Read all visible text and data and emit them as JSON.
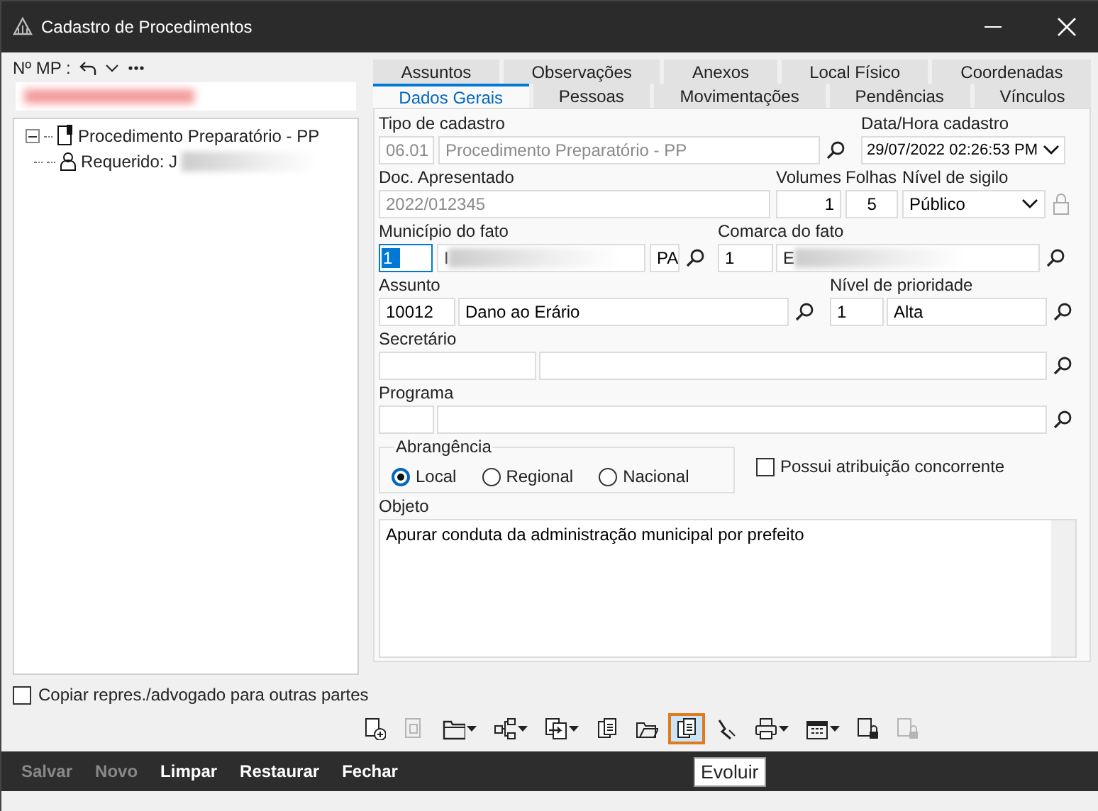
{
  "window": {
    "title": "Cadastro de Procedimentos"
  },
  "mp": {
    "label": "Nº MP :"
  },
  "tree": [
    {
      "label": "Procedimento Preparatório - PP",
      "expanded": true,
      "children": [
        {
          "label": "Requerido: J"
        }
      ]
    }
  ],
  "copy_checkbox": {
    "label": "Copiar repres./advogado para outras partes",
    "checked": false
  },
  "tab_rows": [
    [
      {
        "label": "Assuntos",
        "selected": false
      },
      {
        "label": "Observações",
        "selected": false
      },
      {
        "label": "Anexos",
        "selected": false
      },
      {
        "label": "Local Físico",
        "selected": false
      },
      {
        "label": "Coordenadas",
        "selected": false
      }
    ],
    [
      {
        "label": "Dados Gerais",
        "selected": true
      },
      {
        "label": "Pessoas",
        "selected": false
      },
      {
        "label": "Movimentações",
        "selected": false
      },
      {
        "label": "Pendências",
        "selected": false
      },
      {
        "label": "Vínculos",
        "selected": false
      }
    ]
  ],
  "form": {
    "tipo_cadastro": {
      "label": "Tipo de cadastro",
      "code": "06.01",
      "name": "Procedimento Preparatório - PP",
      "disabled": true
    },
    "data_hora": {
      "label": "Data/Hora cadastro",
      "value": "29/07/2022 02:26:53 PM"
    },
    "doc": {
      "label": "Doc. Apresentado",
      "value": "2022/012345",
      "disabled": true
    },
    "volumes": {
      "label": "Volumes",
      "value": "1"
    },
    "folhas": {
      "label": "Folhas",
      "value": "5"
    },
    "sigilo": {
      "label": "Nível de sigilo",
      "value": "Público"
    },
    "municipio": {
      "label": "Município do fato",
      "code": "1",
      "name": "I",
      "uf": "PA",
      "focused": true
    },
    "comarca": {
      "label": "Comarca do fato",
      "code": "1",
      "name": "E"
    },
    "assunto": {
      "label": "Assunto",
      "code": "10012",
      "name": "Dano ao Erário"
    },
    "prioridade": {
      "label": "Nível de prioridade",
      "code": "1",
      "name": "Alta"
    },
    "secretario": {
      "label": "Secretário"
    },
    "programa": {
      "label": "Programa"
    },
    "abrangencia": {
      "label": "Abrangência",
      "options": [
        {
          "label": "Local",
          "selected": true
        },
        {
          "label": "Regional",
          "selected": false
        },
        {
          "label": "Nacional",
          "selected": false
        }
      ]
    },
    "concorrente": {
      "label": "Possui atribuição concorrente",
      "checked": false
    },
    "objeto": {
      "label": "Objeto",
      "value": "Apurar conduta da administração municipal por prefeito"
    }
  },
  "toolbar": [
    {
      "kind": "add",
      "dropdown": false,
      "disabled": false,
      "highlighted": false
    },
    {
      "kind": "page",
      "dropdown": false,
      "disabled": true,
      "highlighted": false
    },
    {
      "kind": "folder",
      "dropdown": true,
      "disabled": false,
      "highlighted": false
    },
    {
      "kind": "tree",
      "dropdown": true,
      "disabled": false,
      "highlighted": false
    },
    {
      "kind": "transfer",
      "dropdown": true,
      "disabled": false,
      "highlighted": false
    },
    {
      "kind": "copy",
      "dropdown": false,
      "disabled": false,
      "highlighted": false
    },
    {
      "kind": "open",
      "dropdown": false,
      "disabled": false,
      "highlighted": false
    },
    {
      "kind": "copy",
      "dropdown": false,
      "disabled": false,
      "highlighted": true,
      "tooltip": "Evoluir"
    },
    {
      "kind": "sign",
      "dropdown": false,
      "disabled": false,
      "highlighted": false
    },
    {
      "kind": "print",
      "dropdown": true,
      "disabled": false,
      "highlighted": false
    },
    {
      "kind": "calendar",
      "dropdown": true,
      "disabled": false,
      "highlighted": false
    },
    {
      "kind": "lock",
      "dropdown": false,
      "disabled": false,
      "highlighted": false
    },
    {
      "kind": "lock",
      "dropdown": false,
      "disabled": true,
      "highlighted": false
    }
  ],
  "actions": [
    {
      "label": "Salvar",
      "disabled": true
    },
    {
      "label": "Novo",
      "disabled": true
    },
    {
      "label": "Limpar",
      "disabled": false
    },
    {
      "label": "Restaurar",
      "disabled": false
    },
    {
      "label": "Fechar",
      "disabled": false
    }
  ]
}
